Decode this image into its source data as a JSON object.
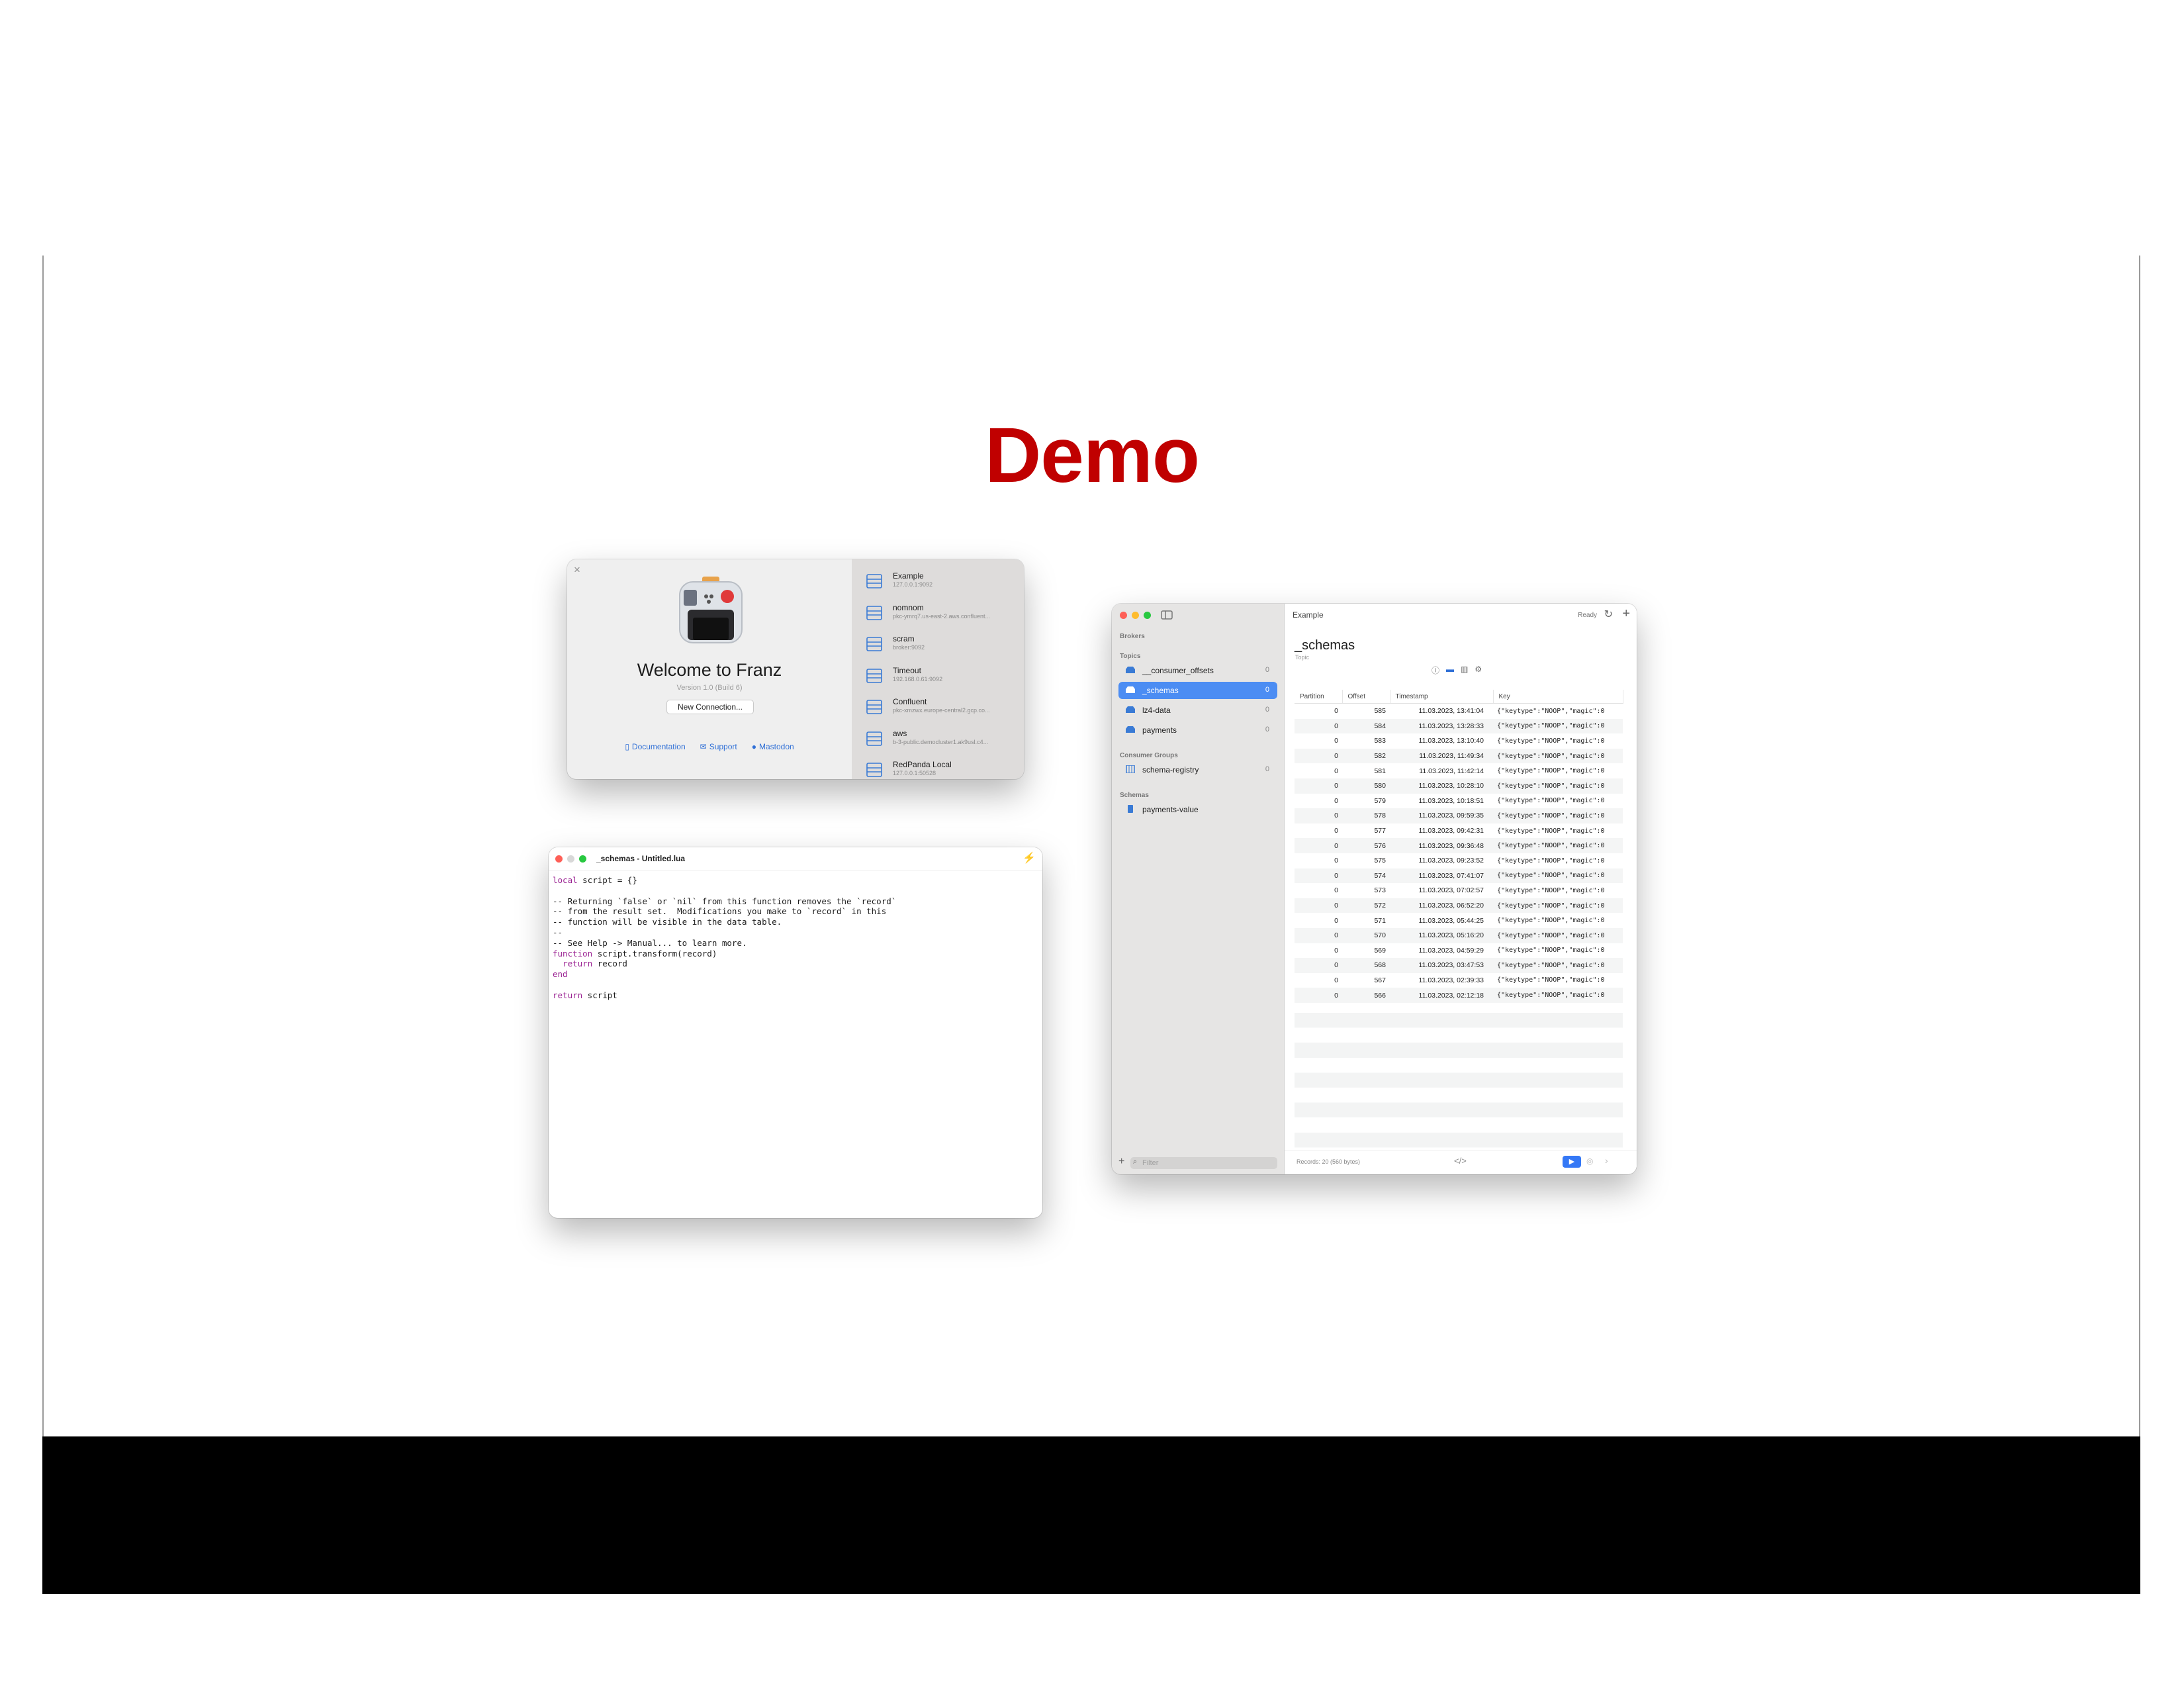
{
  "slide": {
    "title": "Demo"
  },
  "welcome": {
    "close_glyph": "×",
    "title": "Welcome to Franz",
    "version": "Version 1.0 (Build 6)",
    "new_connection": "New Connection...",
    "links": {
      "documentation": "Documentation",
      "support": "Support",
      "mastodon": "Mastodon"
    },
    "connections": [
      {
        "name": "Example",
        "host": "127.0.0.1:9092"
      },
      {
        "name": "nomnom",
        "host": "pkc-ymrq7.us-east-2.aws.confluent..."
      },
      {
        "name": "scram",
        "host": "broker:9092"
      },
      {
        "name": "Timeout",
        "host": "192.168.0.61:9092"
      },
      {
        "name": "Confluent",
        "host": "pkc-xmzwx.europe-central2.gcp.co..."
      },
      {
        "name": "aws",
        "host": "b-3-public.democluster1.ak9usl.c4..."
      },
      {
        "name": "RedPanda Local",
        "host": "127.0.0.1:50528"
      }
    ]
  },
  "editor": {
    "title": "_schemas - Untitled.lua",
    "lines": [
      {
        "text": "local script = {}",
        "kw": "local"
      },
      {
        "text": ""
      },
      {
        "text": "-- Returning `false` or `nil` from this function removes the `record`"
      },
      {
        "text": "-- from the result set.  Modifications you make to `record` in this"
      },
      {
        "text": "-- function will be visible in the data table."
      },
      {
        "text": "--"
      },
      {
        "text": "-- See Help -> Manual... to learn more."
      },
      {
        "text": "function script.transform(record)",
        "kw": "function"
      },
      {
        "text": "  return record",
        "kw": "return"
      },
      {
        "text": "end",
        "kw": "end"
      },
      {
        "text": ""
      },
      {
        "text": "return script",
        "kw": "return"
      }
    ]
  },
  "franz": {
    "window_title": "Example",
    "status": "Ready",
    "sidebar": {
      "brokers_header": "Brokers",
      "topics_header": "Topics",
      "topics": [
        {
          "label": "__consumer_offsets",
          "count": "0"
        },
        {
          "label": "_schemas",
          "count": "0"
        },
        {
          "label": "lz4-data",
          "count": "0"
        },
        {
          "label": "payments",
          "count": "0"
        }
      ],
      "groups_header": "Consumer Groups",
      "groups": [
        {
          "label": "schema-registry",
          "count": "0"
        }
      ],
      "schemas_header": "Schemas",
      "schemas": [
        {
          "label": "payments-value"
        }
      ],
      "filter_placeholder": "Filter"
    },
    "topic": {
      "name": "_schemas",
      "subtitle": "Topic"
    },
    "table": {
      "columns": [
        "Partition",
        "Offset",
        "Timestamp",
        "Key"
      ],
      "key_value": "{\"keytype\":\"NOOP\",\"magic\":0",
      "rows": [
        [
          "0",
          "585",
          "11.03.2023, 13:41:04"
        ],
        [
          "0",
          "584",
          "11.03.2023, 13:28:33"
        ],
        [
          "0",
          "583",
          "11.03.2023, 13:10:40"
        ],
        [
          "0",
          "582",
          "11.03.2023, 11:49:34"
        ],
        [
          "0",
          "581",
          "11.03.2023, 11:42:14"
        ],
        [
          "0",
          "580",
          "11.03.2023, 10:28:10"
        ],
        [
          "0",
          "579",
          "11.03.2023, 10:18:51"
        ],
        [
          "0",
          "578",
          "11.03.2023, 09:59:35"
        ],
        [
          "0",
          "577",
          "11.03.2023, 09:42:31"
        ],
        [
          "0",
          "576",
          "11.03.2023, 09:36:48"
        ],
        [
          "0",
          "575",
          "11.03.2023, 09:23:52"
        ],
        [
          "0",
          "574",
          "11.03.2023, 07:41:07"
        ],
        [
          "0",
          "573",
          "11.03.2023, 07:02:57"
        ],
        [
          "0",
          "572",
          "11.03.2023, 06:52:20"
        ],
        [
          "0",
          "571",
          "11.03.2023, 05:44:25"
        ],
        [
          "0",
          "570",
          "11.03.2023, 05:16:20"
        ],
        [
          "0",
          "569",
          "11.03.2023, 04:59:29"
        ],
        [
          "0",
          "568",
          "11.03.2023, 03:47:53"
        ],
        [
          "0",
          "567",
          "11.03.2023, 02:39:33"
        ],
        [
          "0",
          "566",
          "11.03.2023, 02:12:18"
        ]
      ]
    },
    "footer": {
      "records": "Records: 20 (560 bytes)"
    }
  }
}
